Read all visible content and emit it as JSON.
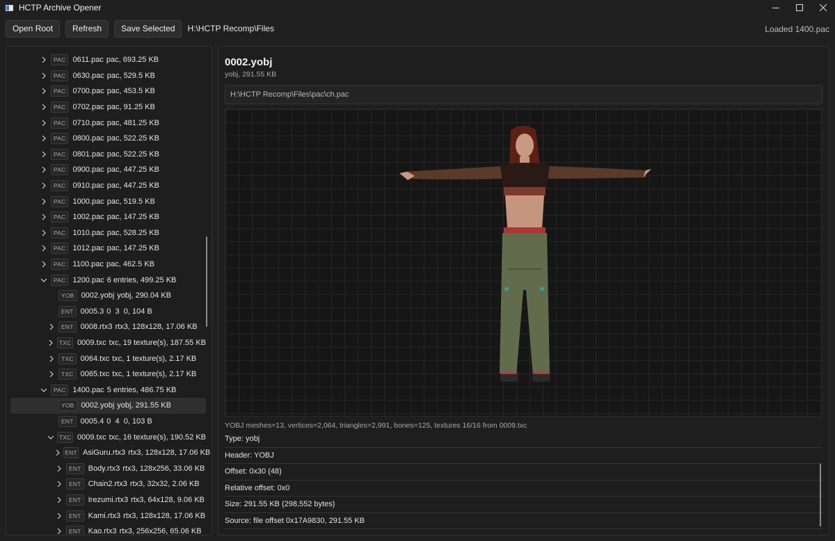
{
  "window": {
    "title": "HCTP Archive Opener",
    "controls": [
      "minimize-icon",
      "maximize-icon",
      "close-icon"
    ]
  },
  "toolbar": {
    "open_root": "Open Root",
    "refresh": "Refresh",
    "save_selected": "Save Selected",
    "path": "H:\\HCTP Recomp\\Files",
    "status": "Loaded 1400.pac"
  },
  "tree": {
    "rows": [
      {
        "indent": 0,
        "chevron": "right",
        "badge": "PAC",
        "name": "0611.pac",
        "meta": "pac, 693.25 KB"
      },
      {
        "indent": 0,
        "chevron": "right",
        "badge": "PAC",
        "name": "0630.pac",
        "meta": "pac, 529.5 KB"
      },
      {
        "indent": 0,
        "chevron": "right",
        "badge": "PAC",
        "name": "0700.pac",
        "meta": "pac, 453.5 KB"
      },
      {
        "indent": 0,
        "chevron": "right",
        "badge": "PAC",
        "name": "0702.pac",
        "meta": "pac, 91.25 KB"
      },
      {
        "indent": 0,
        "chevron": "right",
        "badge": "PAC",
        "name": "0710.pac",
        "meta": "pac, 481.25 KB"
      },
      {
        "indent": 0,
        "chevron": "right",
        "badge": "PAC",
        "name": "0800.pac",
        "meta": "pac, 522.25 KB"
      },
      {
        "indent": 0,
        "chevron": "right",
        "badge": "PAC",
        "name": "0801.pac",
        "meta": "pac, 522.25 KB"
      },
      {
        "indent": 0,
        "chevron": "right",
        "badge": "PAC",
        "name": "0900.pac",
        "meta": "pac, 447.25 KB"
      },
      {
        "indent": 0,
        "chevron": "right",
        "badge": "PAC",
        "name": "0910.pac",
        "meta": "pac, 447.25 KB"
      },
      {
        "indent": 0,
        "chevron": "right",
        "badge": "PAC",
        "name": "1000.pac",
        "meta": "pac, 519.5 KB"
      },
      {
        "indent": 0,
        "chevron": "right",
        "badge": "PAC",
        "name": "1002.pac",
        "meta": "pac, 147.25 KB"
      },
      {
        "indent": 0,
        "chevron": "right",
        "badge": "PAC",
        "name": "1010.pac",
        "meta": "pac, 528.25 KB"
      },
      {
        "indent": 0,
        "chevron": "right",
        "badge": "PAC",
        "name": "1012.pac",
        "meta": "pac, 147.25 KB"
      },
      {
        "indent": 0,
        "chevron": "right",
        "badge": "PAC",
        "name": "1100.pac",
        "meta": "pac, 462.5 KB"
      },
      {
        "indent": 0,
        "chevron": "down",
        "badge": "PAC",
        "name": "1200.pac",
        "meta": "6 entries, 499.25 KB"
      },
      {
        "indent": 1,
        "chevron": "none",
        "badge": "YOB",
        "name": "0002.yobj",
        "meta": "yobj, 290.04 KB"
      },
      {
        "indent": 1,
        "chevron": "none",
        "badge": "ENT",
        "name": "0005.3",
        "meta": "0  3  0, 104 B"
      },
      {
        "indent": 1,
        "chevron": "right",
        "badge": "ENT",
        "name": "0008.rtx3",
        "meta": "rtx3, 128x128, 17.06 KB"
      },
      {
        "indent": 1,
        "chevron": "right",
        "badge": "TXC",
        "name": "0009.txc",
        "meta": "txc, 19 texture(s), 187.55 KB"
      },
      {
        "indent": 1,
        "chevron": "right",
        "badge": "TXC",
        "name": "0064.txc",
        "meta": "txc, 1 texture(s), 2.17 KB"
      },
      {
        "indent": 1,
        "chevron": "right",
        "badge": "TXC",
        "name": "0065.txc",
        "meta": "txc, 1 texture(s), 2.17 KB"
      },
      {
        "indent": 0,
        "chevron": "down",
        "badge": "PAC",
        "name": "1400.pac",
        "meta": "5 entries, 486.75 KB"
      },
      {
        "indent": 1,
        "chevron": "none",
        "badge": "YOB",
        "name": "0002.yobj",
        "meta": "yobj, 291.55 KB",
        "selected": true
      },
      {
        "indent": 1,
        "chevron": "none",
        "badge": "ENT",
        "name": "0005.4",
        "meta": "0  4  0, 103 B"
      },
      {
        "indent": 1,
        "chevron": "down",
        "badge": "TXC",
        "name": "0009.txc",
        "meta": "txc, 16 texture(s), 190.52 KB"
      },
      {
        "indent": 2,
        "chevron": "right",
        "badge": "ENT",
        "name": "AsiGuru.rtx3",
        "meta": "rtx3, 128x128, 17.06 KB"
      },
      {
        "indent": 2,
        "chevron": "right",
        "badge": "ENT",
        "name": "Body.rtx3",
        "meta": "rtx3, 128x256, 33.06 KB"
      },
      {
        "indent": 2,
        "chevron": "right",
        "badge": "ENT",
        "name": "Chain2.rtx3",
        "meta": "rtx3, 32x32, 2.06 KB"
      },
      {
        "indent": 2,
        "chevron": "right",
        "badge": "ENT",
        "name": "Irezumi.rtx3",
        "meta": "rtx3, 64x128, 9.06 KB"
      },
      {
        "indent": 2,
        "chevron": "right",
        "badge": "ENT",
        "name": "Kami.rtx3",
        "meta": "rtx3, 128x128, 17.06 KB"
      },
      {
        "indent": 2,
        "chevron": "right",
        "badge": "ENT",
        "name": "Kao.rtx3",
        "meta": "rtx3, 256x256, 65.06 KB"
      }
    ]
  },
  "detail": {
    "title": "0002.yobj",
    "subtitle": "yobj, 291.55 KB",
    "path": "H:\\HCTP Recomp\\Files\\pac\\ch.pac",
    "stats": "YOBJ meshes=13, vertices=2,064, triangles=2,991, bones=125, textures 16/16 from 0009.txc",
    "properties": [
      "Type: yobj",
      "Header: YOBJ",
      "Offset: 0x30 (48)",
      "Relative offset: 0x0",
      "Size: 291.55 KB (298,552 bytes)",
      "Source: file offset 0x17A9830, 291.55 KB"
    ]
  }
}
